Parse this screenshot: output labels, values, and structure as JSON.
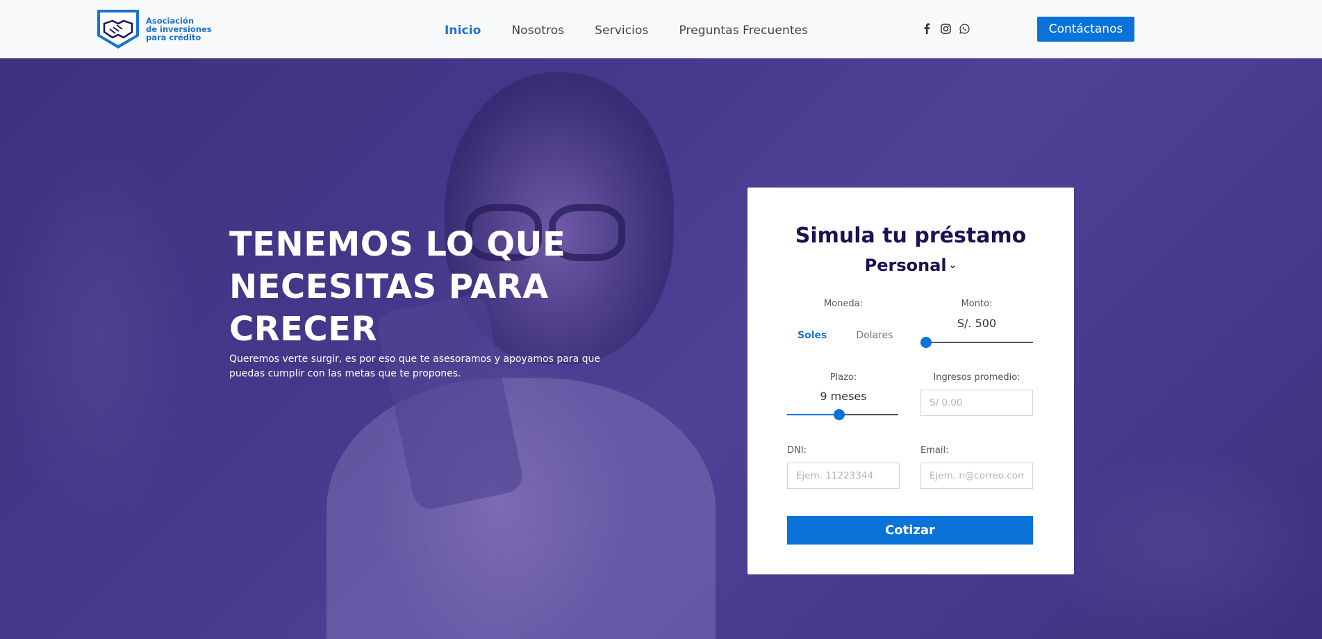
{
  "brand": {
    "line1": "Asociación",
    "line2": "de inversiones",
    "line3": "para crédito",
    "color": "#1a73d6"
  },
  "nav": {
    "items": [
      {
        "label": "Inicio",
        "active": true
      },
      {
        "label": "Nosotros",
        "active": false
      },
      {
        "label": "Servicios",
        "active": false
      },
      {
        "label": "Preguntas Frecuentes",
        "active": false
      }
    ]
  },
  "socials": [
    "facebook-icon",
    "instagram-icon",
    "whatsapp-icon"
  ],
  "header": {
    "contact_label": "Contáctanos"
  },
  "hero": {
    "title": "TENEMOS LO QUE NECESITAS PARA CRECER",
    "subtitle": "Queremos verte surgir, es por eso que te asesoramos y apoyamos para que puedas cumplir con las metas que te propones."
  },
  "simulator": {
    "title": "Simula tu préstamo",
    "loan_type": "Personal",
    "currency_label": "Moneda:",
    "currency_options": [
      "Soles",
      "Dolares"
    ],
    "currency_selected": "Soles",
    "amount_label": "Monto:",
    "amount_value": "S/. 500",
    "amount_slider_fraction": 0.0,
    "term_label": "Plazo:",
    "term_value": "9 meses",
    "term_slider_fraction": 0.47,
    "income_label": "Ingresos promedio:",
    "income_placeholder": "S/ 0.00",
    "dni_label": "DNI:",
    "dni_placeholder": "Ejem. 11223344",
    "email_label": "Email:",
    "email_placeholder": "Ejem. n@correo.com",
    "submit_label": "Cotizar"
  },
  "colors": {
    "accent": "#0a73da",
    "title": "#1a1052"
  }
}
